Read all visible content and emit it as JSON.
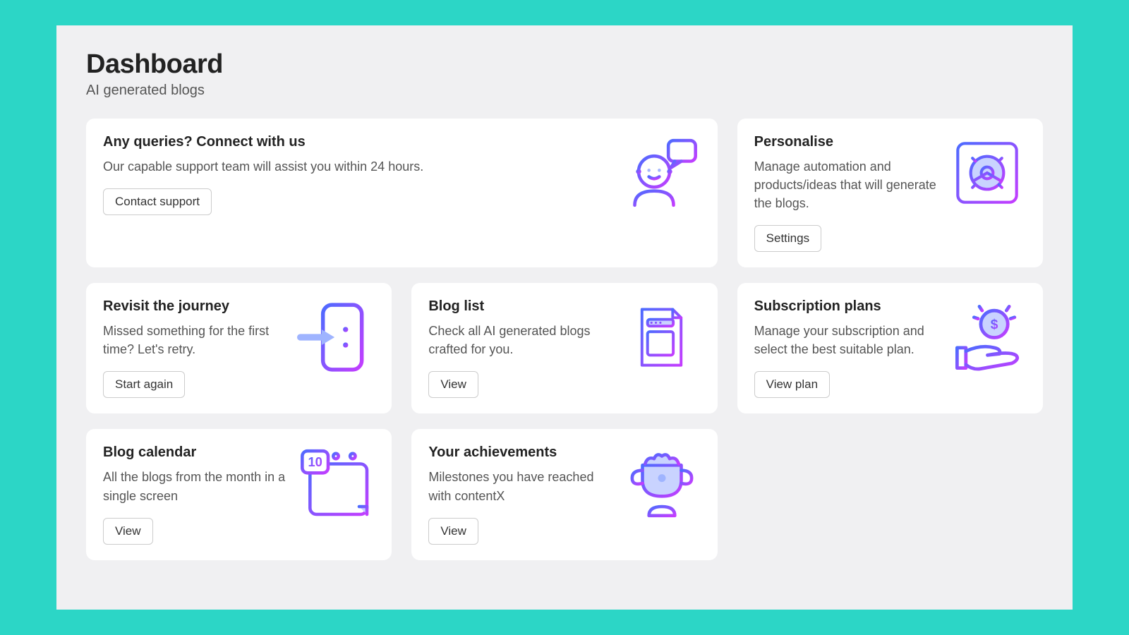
{
  "header": {
    "title": "Dashboard",
    "subtitle": "AI generated blogs"
  },
  "cards": {
    "support": {
      "title": "Any queries? Connect with us",
      "desc": "Our capable support team will assist you within 24 hours.",
      "button": "Contact support"
    },
    "personalise": {
      "title": "Personalise",
      "desc": "Manage automation and products/ideas that will generate the blogs.",
      "button": "Settings"
    },
    "revisit": {
      "title": "Revisit the journey",
      "desc": "Missed something for the first time? Let's retry.",
      "button": "Start again"
    },
    "bloglist": {
      "title": "Blog list",
      "desc": "Check all AI generated blogs crafted for you.",
      "button": "View"
    },
    "subscription": {
      "title": "Subscription plans",
      "desc": "Manage your subscription and select the best suitable plan.",
      "button": "View plan"
    },
    "calendar": {
      "title": "Blog calendar",
      "desc": "All the blogs from the month in a single screen",
      "button": "View"
    },
    "achievements": {
      "title": "Your achievements",
      "desc": "Milestones you have reached with contentX",
      "button": "View"
    }
  }
}
